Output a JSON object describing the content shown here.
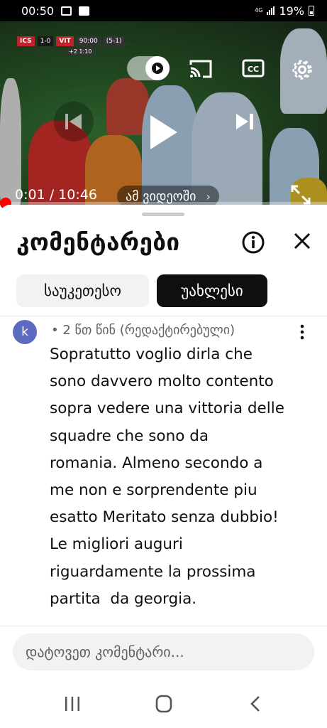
{
  "status_bar": {
    "time": "00:50",
    "network": "4G",
    "battery": "19%"
  },
  "video": {
    "scoreboard": {
      "home": "ICS",
      "score": "1-0",
      "away": "VIT",
      "clock": "90:00",
      "aggregate": "(5-1)",
      "added": "+2 1:10"
    },
    "time_current": "0:01",
    "time_separator": " / ",
    "time_total": "10:46",
    "in_video_label": "ამ ვიდეოში",
    "progress": 0.0016,
    "autoplay_on": true
  },
  "comments_panel": {
    "title": "კომენტარები",
    "sort_chips": [
      {
        "label": "საუკეთესო",
        "selected": false
      },
      {
        "label": "უახლესი",
        "selected": true
      }
    ],
    "comments": [
      {
        "avatar_letter": "k",
        "meta": "• 2 წთ წინ (რედაქტირებული)",
        "text": "Sopratutto voglio dirla che\nsono davvero molto contento\nsopra vedere una vittoria delle\nsquadre che sono da\nromania. Almeno secondo a\nme non e sorprendente piu\nesatto Meritato senza dubbio!\nLe migliori auguri\nriguardamente la prossima\npartita  da georgia."
      }
    ],
    "input_placeholder": "დატოვეთ კომენტარი..."
  },
  "colors": {
    "accent_red": "#ff0000",
    "avatar": "#5c6bc0",
    "selected_chip": "#0f0f0f",
    "chip_bg": "#f2f2f2"
  },
  "icons": [
    "autoplay-toggle-icon",
    "cast-icon",
    "cc-icon",
    "gear-icon",
    "previous-icon",
    "play-icon",
    "next-icon",
    "fullscreen-icon",
    "info-icon",
    "close-icon",
    "kebab-menu-icon",
    "recents-icon",
    "home-icon",
    "back-icon"
  ]
}
